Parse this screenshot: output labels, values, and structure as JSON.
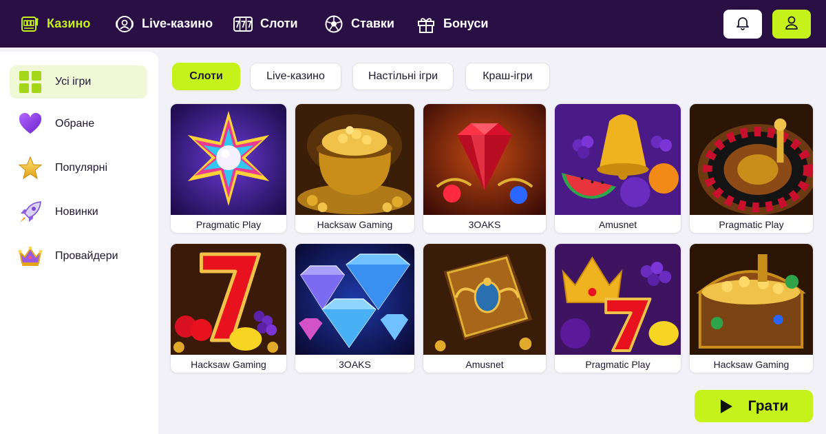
{
  "topbar": {
    "nav": [
      {
        "label": "Казино",
        "icon": "slot-machine-icon",
        "active": true
      },
      {
        "label": "Live-казино",
        "icon": "live-dealer-icon"
      },
      {
        "label": "Слоти",
        "icon": "777-icon"
      },
      {
        "label": "Ставки",
        "icon": "soccer-ball-icon"
      },
      {
        "label": "Бонуси",
        "icon": "gift-icon"
      }
    ],
    "notifications_icon": "bell-icon",
    "profile_icon": "user-icon"
  },
  "sidebar": {
    "items": [
      {
        "label": "Усі ігри",
        "icon": "grid-icon",
        "active": true
      },
      {
        "label": "Обране",
        "icon": "heart-icon"
      },
      {
        "label": "Популярні",
        "icon": "star-icon"
      },
      {
        "label": "Новинки",
        "icon": "rocket-icon"
      },
      {
        "label": "Провайдери",
        "icon": "crown-icon"
      }
    ]
  },
  "filters": [
    {
      "label": "Слоти",
      "active": true
    },
    {
      "label": "Live-казино"
    },
    {
      "label": "Настільні ігри"
    },
    {
      "label": "Краш-ігри"
    }
  ],
  "games": [
    {
      "provider": "Pragmatic Play",
      "art": "starburst-gem"
    },
    {
      "provider": "Hacksaw Gaming",
      "art": "pot-of-gold"
    },
    {
      "provider": "3OAKS",
      "art": "red-diamond"
    },
    {
      "provider": "Amusnet",
      "art": "fruits-bell"
    },
    {
      "provider": "Pragmatic Play",
      "art": "roulette-wheel"
    },
    {
      "provider": "Hacksaw Gaming",
      "art": "lucky-seven-fruits"
    },
    {
      "provider": "3OAKS",
      "art": "blue-diamonds"
    },
    {
      "provider": "Amusnet",
      "art": "book-of-scarab"
    },
    {
      "provider": "Pragmatic Play",
      "art": "crown-seven"
    },
    {
      "provider": "Hacksaw Gaming",
      "art": "treasure-chest"
    }
  ],
  "play_button": {
    "label": "Грати",
    "icon": "play-icon"
  },
  "colors": {
    "accent": "#c6f21c",
    "header_bg": "#2a0f44",
    "page_bg": "#f3f1f8"
  }
}
